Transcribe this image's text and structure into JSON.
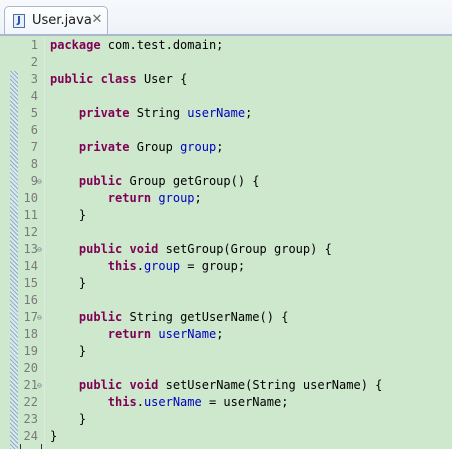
{
  "editor_tab": {
    "file_icon_letter": "J",
    "title": "User.java",
    "close_glyph": "✕",
    "icon": "java-file-icon"
  },
  "colors": {
    "editor_background": "#cde8cd",
    "keyword": "#7f0055",
    "field": "#0000c0",
    "line_number": "#7a7a7a"
  },
  "lines": [
    {
      "n": "1",
      "fold": "",
      "segments": [
        {
          "t": "package",
          "k": "kw"
        },
        {
          "t": " com.test.domain;",
          "k": ""
        }
      ]
    },
    {
      "n": "2",
      "fold": "",
      "segments": []
    },
    {
      "n": "3",
      "fold": "",
      "segments": [
        {
          "t": "public",
          "k": "kw"
        },
        {
          "t": " ",
          "k": ""
        },
        {
          "t": "class",
          "k": "kw"
        },
        {
          "t": " User {",
          "k": ""
        }
      ]
    },
    {
      "n": "4",
      "fold": "",
      "segments": []
    },
    {
      "n": "5",
      "fold": "",
      "segments": [
        {
          "t": "    ",
          "k": ""
        },
        {
          "t": "private",
          "k": "kw"
        },
        {
          "t": " String ",
          "k": ""
        },
        {
          "t": "userName",
          "k": "fld"
        },
        {
          "t": ";",
          "k": ""
        }
      ]
    },
    {
      "n": "6",
      "fold": "",
      "segments": []
    },
    {
      "n": "7",
      "fold": "",
      "segments": [
        {
          "t": "    ",
          "k": ""
        },
        {
          "t": "private",
          "k": "kw"
        },
        {
          "t": " Group ",
          "k": ""
        },
        {
          "t": "group",
          "k": "fld"
        },
        {
          "t": ";",
          "k": ""
        }
      ]
    },
    {
      "n": "8",
      "fold": "",
      "segments": []
    },
    {
      "n": "9",
      "fold": "⊖",
      "segments": [
        {
          "t": "    ",
          "k": ""
        },
        {
          "t": "public",
          "k": "kw"
        },
        {
          "t": " Group getGroup() {",
          "k": ""
        }
      ]
    },
    {
      "n": "10",
      "fold": "",
      "segments": [
        {
          "t": "        ",
          "k": ""
        },
        {
          "t": "return",
          "k": "kw"
        },
        {
          "t": " ",
          "k": ""
        },
        {
          "t": "group",
          "k": "fld"
        },
        {
          "t": ";",
          "k": ""
        }
      ]
    },
    {
      "n": "11",
      "fold": "",
      "segments": [
        {
          "t": "    }",
          "k": ""
        }
      ]
    },
    {
      "n": "12",
      "fold": "",
      "segments": []
    },
    {
      "n": "13",
      "fold": "⊖",
      "segments": [
        {
          "t": "    ",
          "k": ""
        },
        {
          "t": "public",
          "k": "kw"
        },
        {
          "t": " ",
          "k": ""
        },
        {
          "t": "void",
          "k": "kw"
        },
        {
          "t": " setGroup(Group group) {",
          "k": ""
        }
      ]
    },
    {
      "n": "14",
      "fold": "",
      "segments": [
        {
          "t": "        ",
          "k": ""
        },
        {
          "t": "this",
          "k": "kw"
        },
        {
          "t": ".",
          "k": ""
        },
        {
          "t": "group",
          "k": "fld"
        },
        {
          "t": " = group;",
          "k": ""
        }
      ]
    },
    {
      "n": "15",
      "fold": "",
      "segments": [
        {
          "t": "    }",
          "k": ""
        }
      ]
    },
    {
      "n": "16",
      "fold": "",
      "segments": []
    },
    {
      "n": "17",
      "fold": "⊖",
      "segments": [
        {
          "t": "    ",
          "k": ""
        },
        {
          "t": "public",
          "k": "kw"
        },
        {
          "t": " String getUserName() {",
          "k": ""
        }
      ]
    },
    {
      "n": "18",
      "fold": "",
      "segments": [
        {
          "t": "        ",
          "k": ""
        },
        {
          "t": "return",
          "k": "kw"
        },
        {
          "t": " ",
          "k": ""
        },
        {
          "t": "userName",
          "k": "fld"
        },
        {
          "t": ";",
          "k": ""
        }
      ]
    },
    {
      "n": "19",
      "fold": "",
      "segments": [
        {
          "t": "    }",
          "k": ""
        }
      ]
    },
    {
      "n": "20",
      "fold": "",
      "segments": []
    },
    {
      "n": "21",
      "fold": "⊖",
      "segments": [
        {
          "t": "    ",
          "k": ""
        },
        {
          "t": "public",
          "k": "kw"
        },
        {
          "t": " ",
          "k": ""
        },
        {
          "t": "void",
          "k": "kw"
        },
        {
          "t": " setUserName(String userName) {",
          "k": ""
        }
      ]
    },
    {
      "n": "22",
      "fold": "",
      "segments": [
        {
          "t": "        ",
          "k": ""
        },
        {
          "t": "this",
          "k": "kw"
        },
        {
          "t": ".",
          "k": ""
        },
        {
          "t": "userName",
          "k": "fld"
        },
        {
          "t": " = userName;",
          "k": ""
        }
      ]
    },
    {
      "n": "23",
      "fold": "",
      "segments": [
        {
          "t": "    }",
          "k": ""
        }
      ]
    },
    {
      "n": "24",
      "fold": "",
      "segments": [
        {
          "t": "}",
          "k": ""
        }
      ]
    }
  ]
}
